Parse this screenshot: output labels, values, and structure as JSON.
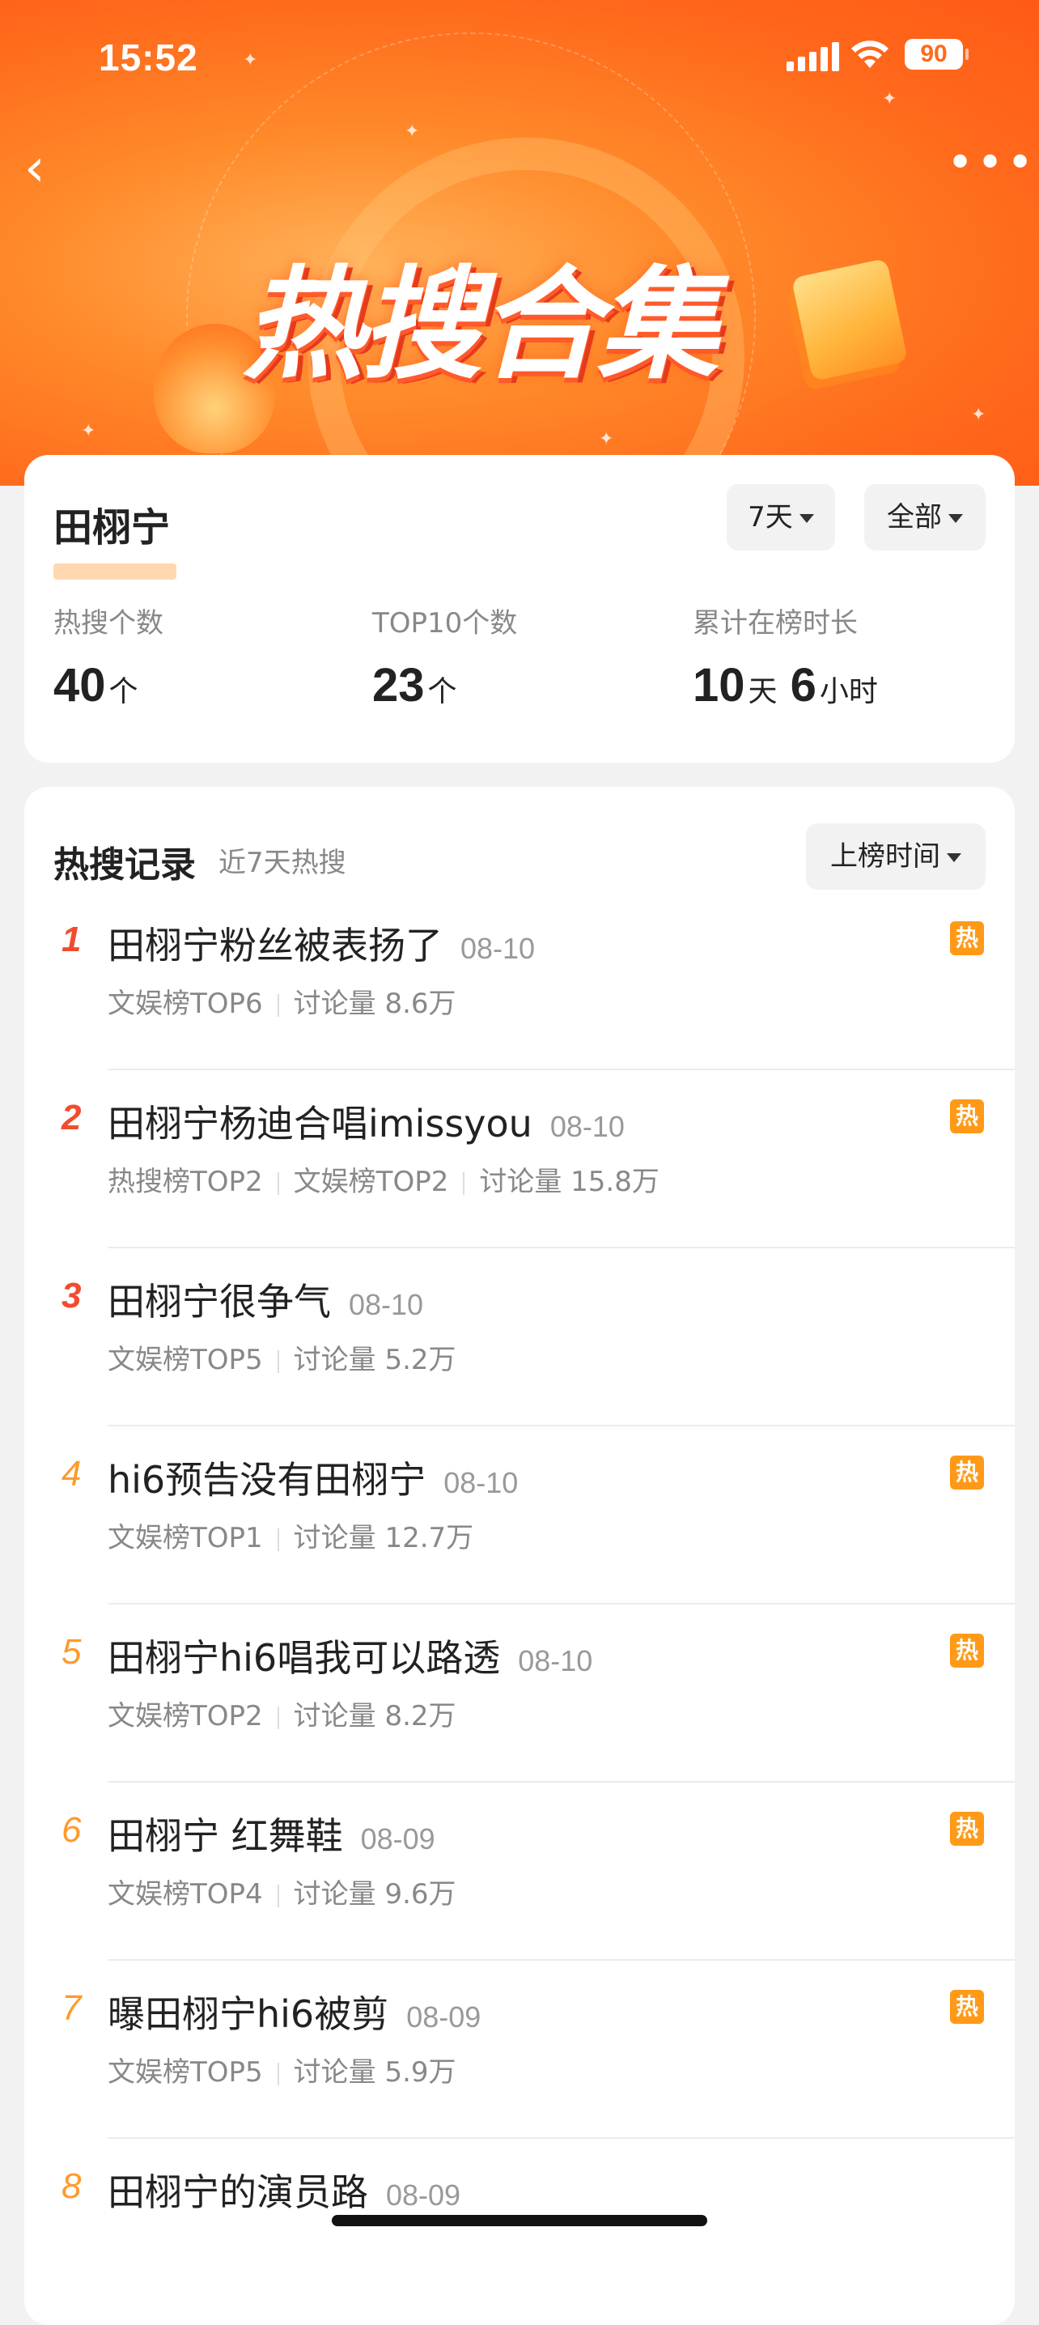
{
  "status_bar": {
    "time": "15:52",
    "battery": "90"
  },
  "header": {
    "back_icon": "‹",
    "more_icon": "•••",
    "banner_title": "热搜合集"
  },
  "summary": {
    "name": "田栩宁",
    "filter_days": "7天",
    "filter_type": "全部",
    "stats": [
      {
        "label": "热搜个数",
        "value": "40",
        "unit": "个"
      },
      {
        "label": "TOP10个数",
        "value": "23",
        "unit": "个"
      },
      {
        "label": "累计在榜时长",
        "value1": "10",
        "unit1": "天",
        "value2": "6",
        "unit2": "小时"
      }
    ]
  },
  "records": {
    "title": "热搜记录",
    "subtitle": "近7天热搜",
    "sort_label": "上榜时间",
    "hot_badge_label": "热",
    "items": [
      {
        "rank": "1",
        "title": "田栩宁粉丝被表扬了",
        "date": "08-10",
        "meta": [
          "文娱榜TOP6",
          "讨论量 8.6万"
        ],
        "hot": true
      },
      {
        "rank": "2",
        "title": "田栩宁杨迪合唱imissyou",
        "date": "08-10",
        "meta": [
          "热搜榜TOP2",
          "文娱榜TOP2",
          "讨论量 15.8万"
        ],
        "hot": true
      },
      {
        "rank": "3",
        "title": "田栩宁很争气",
        "date": "08-10",
        "meta": [
          "文娱榜TOP5",
          "讨论量 5.2万"
        ],
        "hot": false
      },
      {
        "rank": "4",
        "title": "hi6预告没有田栩宁",
        "date": "08-10",
        "meta": [
          "文娱榜TOP1",
          "讨论量 12.7万"
        ],
        "hot": true
      },
      {
        "rank": "5",
        "title": "田栩宁hi6唱我可以路透",
        "date": "08-10",
        "meta": [
          "文娱榜TOP2",
          "讨论量 8.2万"
        ],
        "hot": true
      },
      {
        "rank": "6",
        "title": "田栩宁 红舞鞋",
        "date": "08-09",
        "meta": [
          "文娱榜TOP4",
          "讨论量 9.6万"
        ],
        "hot": true
      },
      {
        "rank": "7",
        "title": "曝田栩宁hi6被剪",
        "date": "08-09",
        "meta": [
          "文娱榜TOP5",
          "讨论量 5.9万"
        ],
        "hot": true
      },
      {
        "rank": "8",
        "title": "田栩宁的演员路",
        "date": "08-09",
        "meta": [],
        "hot": false
      }
    ]
  },
  "colors": {
    "accent": "#ff6a1c",
    "rank_top": "#f24c2e",
    "rank_other": "#ff9a2a",
    "hot_badge": "#ff9a18"
  }
}
